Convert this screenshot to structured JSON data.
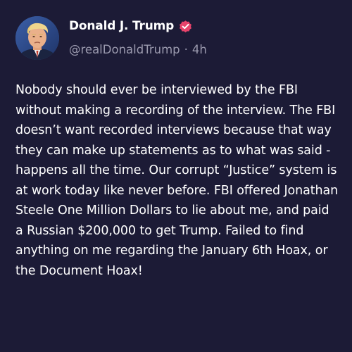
{
  "author": {
    "display_name": "Donald J. Trump",
    "handle": "@realDonaldTrump",
    "separator": "·",
    "timestamp": "4h",
    "verified_badge_color": "#e8436b"
  },
  "post": {
    "text": "Nobody should ever be interviewed by the FBI without making a recording of the interview. The FBI doesn’t want recorded interviews because that way they can make up statements as to what was said - happens all the time. Our corrupt “Justice” system is at work today like never before. FBI offered Jonathan Steele One Million Dollars to lie about me, and paid a Russian $200,000 to get Trump. Failed to find anything on me regarding the January 6th Hoax, or the Document Hoax!"
  },
  "colors": {
    "background": "#1c1b36",
    "text": "#ffffff",
    "muted_text": "#9b9aae"
  },
  "icons": {
    "avatar": "profile-photo",
    "verified": "verified-badge-icon"
  }
}
